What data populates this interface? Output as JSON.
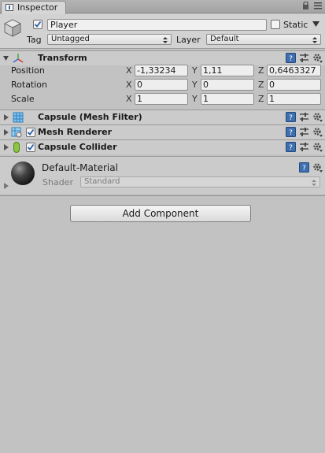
{
  "tab": {
    "title": "Inspector"
  },
  "object": {
    "active": true,
    "name": "Player",
    "static_label": "Static",
    "static_checked": false,
    "tag_label": "Tag",
    "tag_value": "Untagged",
    "layer_label": "Layer",
    "layer_value": "Default"
  },
  "transform": {
    "title": "Transform",
    "rows": [
      {
        "label": "Position",
        "x": "-1,33234",
        "y": "1,11",
        "z": "0,6463327"
      },
      {
        "label": "Rotation",
        "x": "0",
        "y": "0",
        "z": "0"
      },
      {
        "label": "Scale",
        "x": "1",
        "y": "1",
        "z": "1"
      }
    ],
    "axes": {
      "x": "X",
      "y": "Y",
      "z": "Z"
    }
  },
  "components": [
    {
      "title": "Capsule (Mesh Filter)",
      "has_checkbox": false
    },
    {
      "title": "Mesh Renderer",
      "has_checkbox": true,
      "enabled": true
    },
    {
      "title": "Capsule Collider",
      "has_checkbox": true,
      "enabled": true
    }
  ],
  "material": {
    "name": "Default-Material",
    "shader_label": "Shader",
    "shader_value": "Standard"
  },
  "add_component_label": "Add Component",
  "colors": {
    "background": "#c2c2c2",
    "header": "#cbcbcb",
    "field": "#eeeeee"
  }
}
